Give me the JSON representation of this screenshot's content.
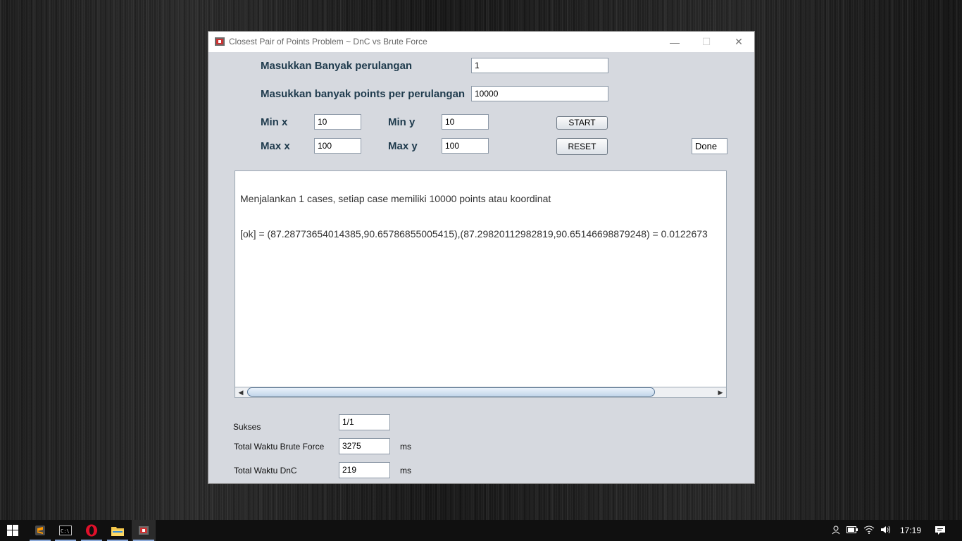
{
  "window": {
    "title": "Closest Pair of Points Problem ~ DnC vs Brute Force",
    "minimize": "—",
    "maximize": "☐",
    "close": "✕"
  },
  "form": {
    "loops_label": "Masukkan Banyak perulangan",
    "loops_value": "1",
    "points_label": "Masukkan banyak points per perulangan",
    "points_value": "10000",
    "min_x_label": "Min x",
    "min_x_value": "10",
    "min_y_label": "Min y",
    "min_y_value": "10",
    "max_x_label": "Max x",
    "max_x_value": "100",
    "max_y_label": "Max y",
    "max_y_value": "100",
    "start_label": "START",
    "reset_label": "RESET",
    "status_value": "Done"
  },
  "output": {
    "line1": "Menjalankan 1 cases, setiap case memiliki 10000 points atau koordinat",
    "line2": "[ok] = (87.28773654014385,90.65786855005415),(87.29820112982819,90.65146698879248) = 0.0122673"
  },
  "summary": {
    "success_label": "Sukses",
    "success_value": "1/1",
    "brute_label": "Total Waktu Brute Force",
    "brute_value": "3275",
    "brute_unit": "ms",
    "dnc_label": "Total Waktu DnC",
    "dnc_value": "219",
    "dnc_unit": "ms"
  },
  "taskbar": {
    "clock": "17:19",
    "icons": [
      "windows-start-icon",
      "sublime-text-icon",
      "command-prompt-icon",
      "opera-icon",
      "file-explorer-icon",
      "java-app-icon"
    ]
  }
}
